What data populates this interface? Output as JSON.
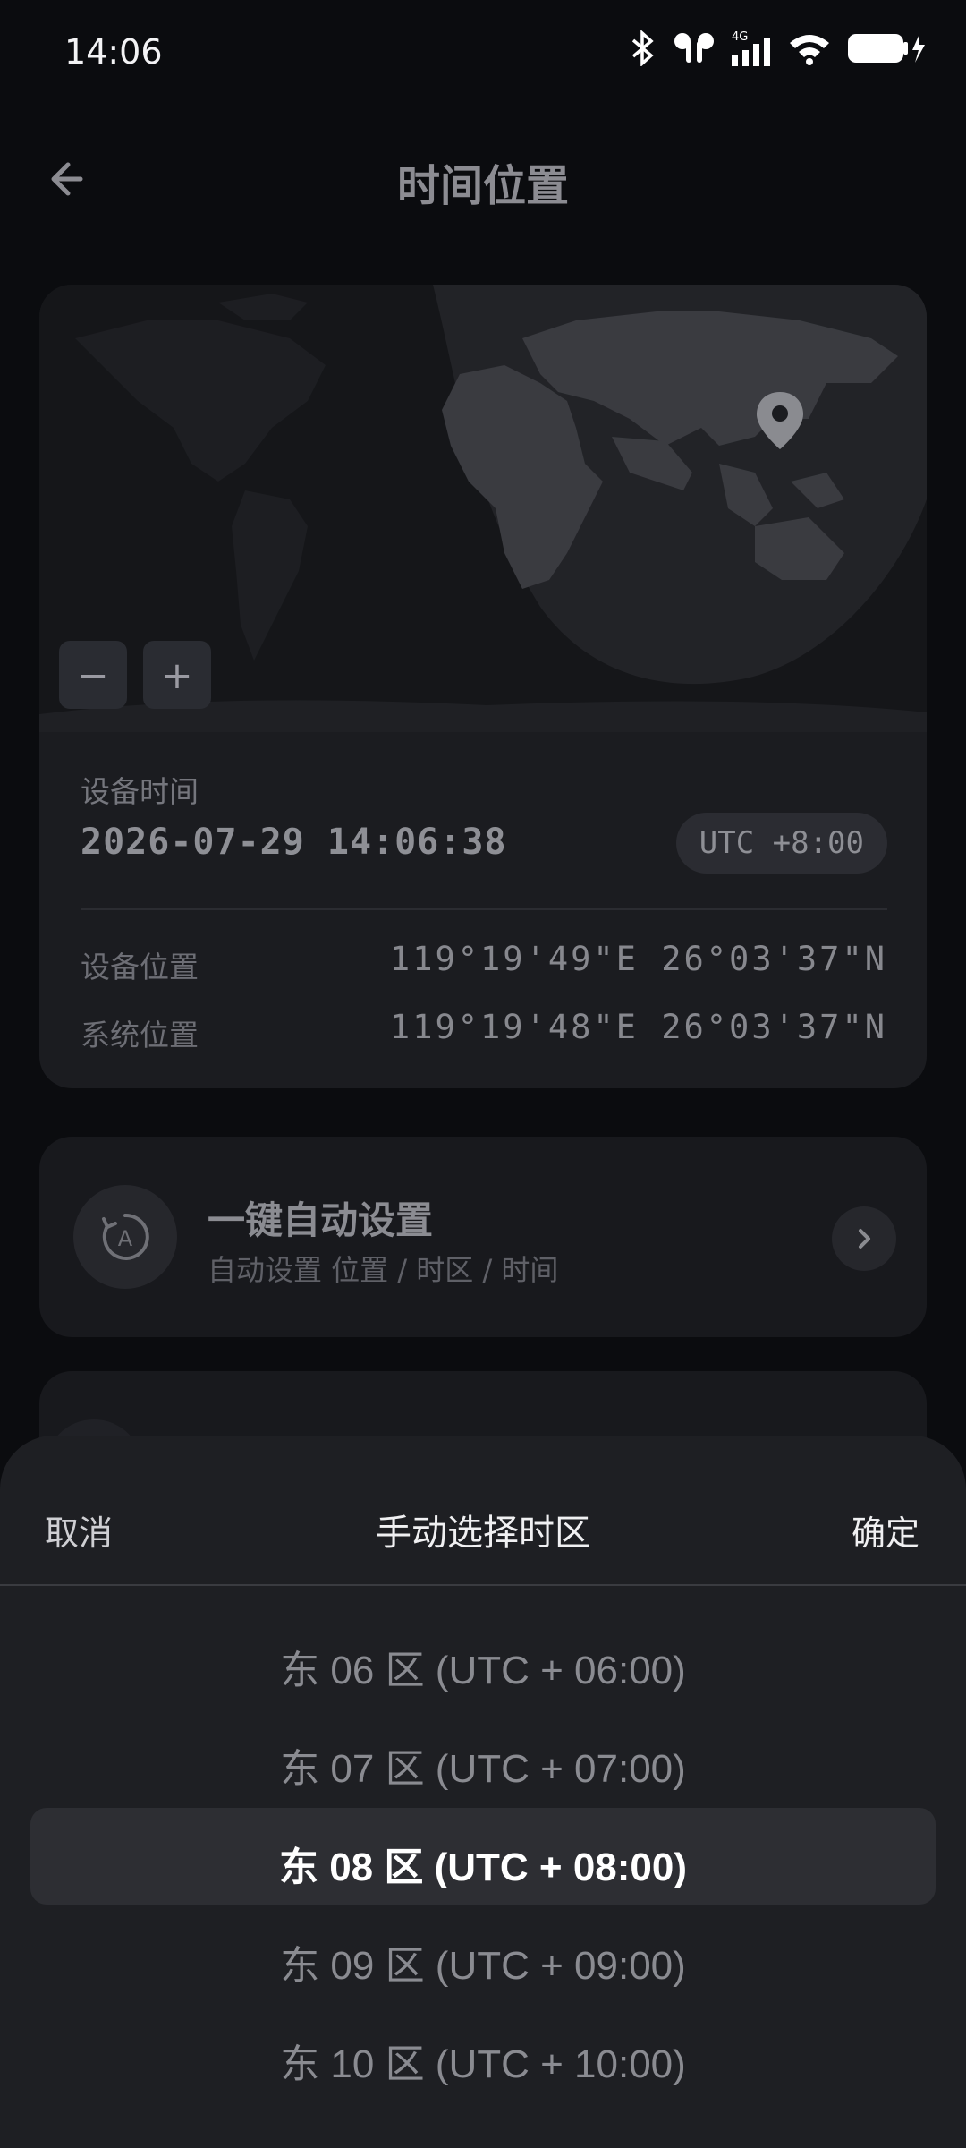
{
  "status_bar": {
    "time": "14:06",
    "network": "4G"
  },
  "header": {
    "title": "时间位置",
    "back_icon": "back-arrow-icon"
  },
  "map": {
    "zoom_out": "−",
    "zoom_in": "+",
    "marker_icon": "location-pin-icon"
  },
  "device_time": {
    "label": "设备时间",
    "value": "2026-07-29 14:06:38",
    "utc": "UTC +8:00"
  },
  "device_location": {
    "label": "设备位置",
    "value": "119°19'49\"E 26°03'37\"N"
  },
  "system_location": {
    "label": "系统位置",
    "value": "119°19'48\"E 26°03'37\"N"
  },
  "auto_setting": {
    "title": "一键自动设置",
    "subtitle": "自动设置 位置 / 时区 / 时间"
  },
  "sheet": {
    "cancel": "取消",
    "title": "手动选择时区",
    "confirm": "确定",
    "options": [
      "东 06 区 (UTC + 06:00)",
      "东 07 区 (UTC + 07:00)",
      "东 08 区 (UTC + 08:00)",
      "东 09 区 (UTC + 09:00)",
      "东 10 区 (UTC + 10:00)"
    ],
    "selected": "东 08 区 (UTC + 08:00)"
  },
  "colors": {
    "background": "#0b0c0f",
    "card": "#1b1c20",
    "sheet": "#1e1f23",
    "highlight": "#2d2e33"
  }
}
